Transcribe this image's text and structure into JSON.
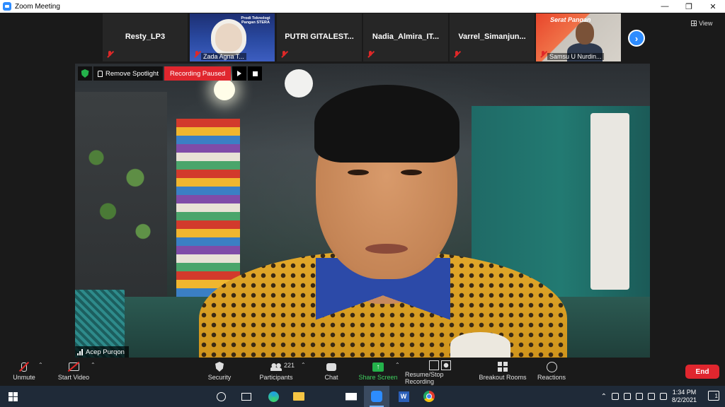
{
  "window": {
    "title": "Zoom Meeting"
  },
  "gallery": {
    "participants": [
      {
        "name": "Resty_LP3",
        "muted": true,
        "video": false
      },
      {
        "name": "Zada Agna T...",
        "muted": true,
        "video": true,
        "banner": "Prodi Teknologi Pangan STERA"
      },
      {
        "name": "PUTRI GITALEST...",
        "muted": true,
        "video": false
      },
      {
        "name": "Nadia_Almira_IT...",
        "muted": true,
        "video": false
      },
      {
        "name": "Varrel_Simanjun...",
        "muted": true,
        "video": false
      },
      {
        "name": "Samsu U Nurdin...",
        "muted": true,
        "video": true,
        "banner": "Serat Pangan"
      }
    ],
    "view_label": "View"
  },
  "main_video": {
    "remove_spotlight_label": "Remove Spotlight",
    "recording_status": "Recording Paused",
    "speaker_name": "Acep Purqon"
  },
  "toolbar": {
    "unmute": "Unmute",
    "start_video": "Start Video",
    "security": "Security",
    "participants": "Participants",
    "participants_count": "221",
    "chat": "Chat",
    "share_screen": "Share Screen",
    "recording": "Resume/Stop Recording",
    "breakout_rooms": "Breakout Rooms",
    "reactions": "Reactions",
    "end": "End"
  },
  "taskbar": {
    "time": "1:34 PM",
    "date": "8/2/2021",
    "word_letter": "W",
    "notifications_count": "1"
  },
  "colors": {
    "zoom_blue": "#2d8cff",
    "end_red": "#e0262e",
    "share_green": "#24b24b",
    "mute_red": "#e02828"
  }
}
